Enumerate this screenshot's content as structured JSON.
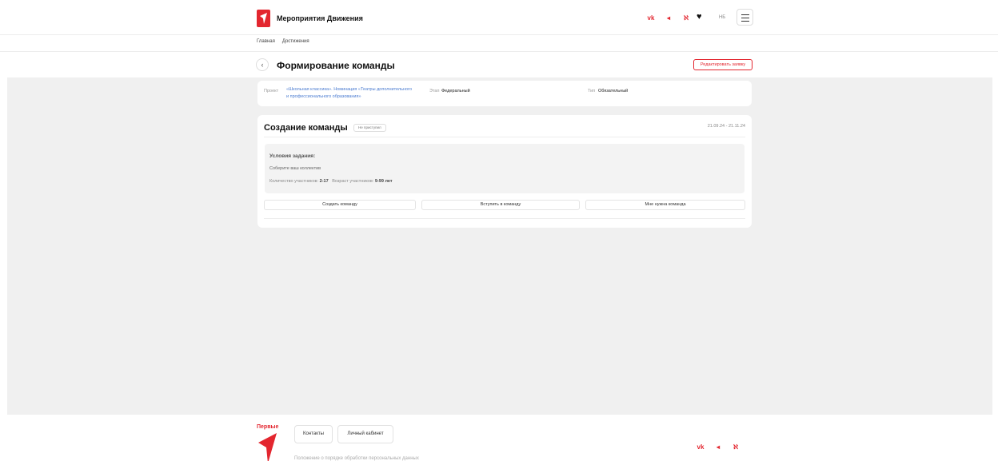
{
  "header": {
    "site_title": "Мероприятия Движения",
    "socials": [
      {
        "icon": "vk-icon",
        "glyph": "vk"
      },
      {
        "icon": "telegram-icon",
        "glyph": "◂"
      },
      {
        "icon": "ok-icon",
        "glyph": "ℵ"
      }
    ],
    "language": "НБ",
    "accent_color": "#e3262f"
  },
  "breadcrumb": [
    "Главная",
    "Достижения"
  ],
  "page": {
    "title": "Формирование команды",
    "edit_button": "Редактировать заявку"
  },
  "info": {
    "project_label": "Проект",
    "project_value": "«Школьная классика». Номинация «Театры дополнительного и профессионального образования»",
    "stage_label": "Этап",
    "stage_value": "Федеральный",
    "type_label": "Тип",
    "type_value": "Обязательный"
  },
  "team": {
    "title": "Создание команды",
    "status": "Не приступил",
    "dates": "21.09.24 - 21.11.24",
    "conditions_title": "Условия задания:",
    "conditions_text": "Соберите ваш коллектив",
    "count_label": "Количество участников:",
    "count_value": "2-17",
    "age_label": "Возраст участников:",
    "age_value": "9-99 лет",
    "buttons": {
      "create": "Создать команду",
      "join": "Вступить в команду",
      "need": "Мне нужна команда"
    }
  },
  "footer": {
    "brand": "Первые",
    "contacts": "Контакты",
    "cabinet": "Личный кабинет",
    "partial_text": "Положение о порядке обработки персональных данных"
  }
}
